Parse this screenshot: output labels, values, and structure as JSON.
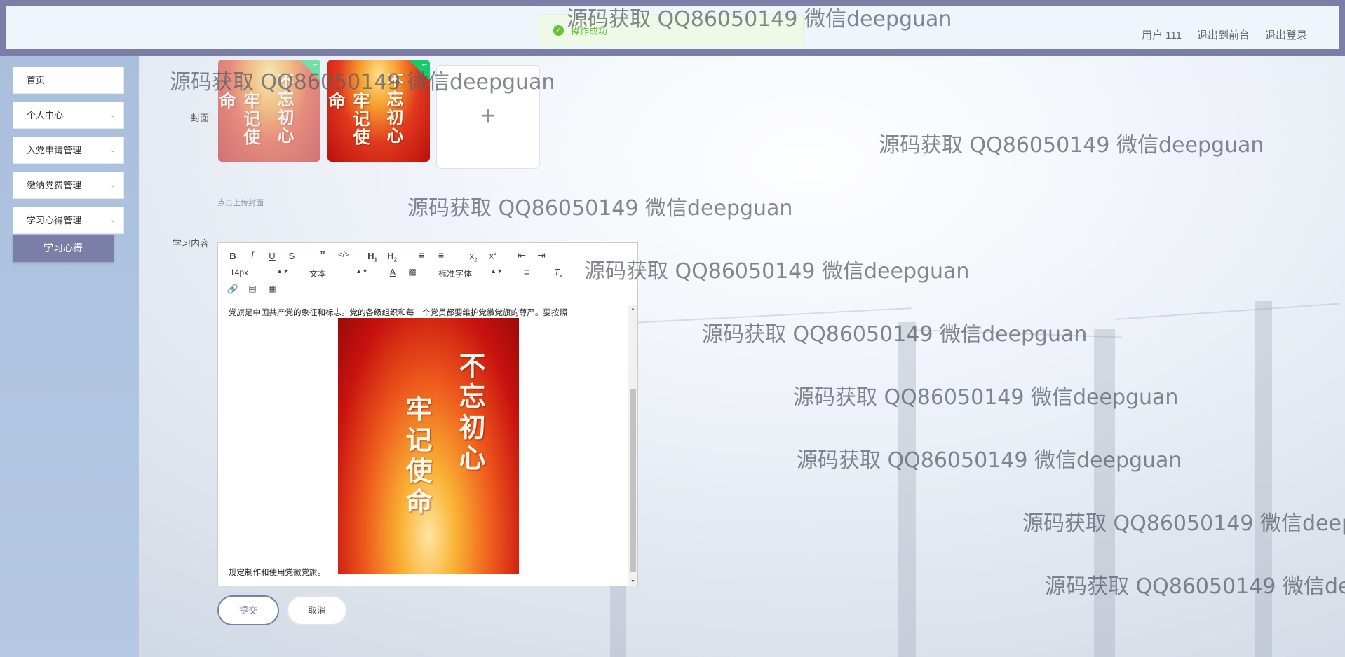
{
  "header": {
    "user_label": "用户 111",
    "back_to_front": "退出到前台",
    "logout": "退出登录"
  },
  "toast": {
    "icon": "check-circle-icon",
    "message": "操作成功"
  },
  "sidebar": {
    "items": [
      {
        "label": "首页",
        "has_arrow": false
      },
      {
        "label": "个人中心",
        "has_arrow": true
      },
      {
        "label": "入党申请管理",
        "has_arrow": true
      },
      {
        "label": "缴纳党费管理",
        "has_arrow": true
      },
      {
        "label": "学习心得管理",
        "has_arrow": true
      }
    ],
    "active_submenu": "学习心得"
  },
  "form": {
    "cover_label": "封面",
    "cover_hint": "点击上传封面",
    "upload_icon": "plus-icon",
    "content_label": "学习内容",
    "poster_text": [
      "不忘初心",
      "牢记使命"
    ]
  },
  "editor": {
    "font_size": "14px",
    "header_select": "文本",
    "font_family": "标准字体",
    "paragraph_1": "党旗是中国共产党的象征和标志。党的各级组织和每一个党员都要维护党徽党旗的尊严。要按照",
    "paragraph_2": "规定制作和使用党徽党旗。"
  },
  "buttons": {
    "submit": "提交",
    "cancel": "取消"
  },
  "watermark_text": "源码获取 QQ86050149 微信deepguan",
  "colors": {
    "accent": "#7b7ea6",
    "success": "#67c23a",
    "sidebar": "#b5c9e4"
  }
}
